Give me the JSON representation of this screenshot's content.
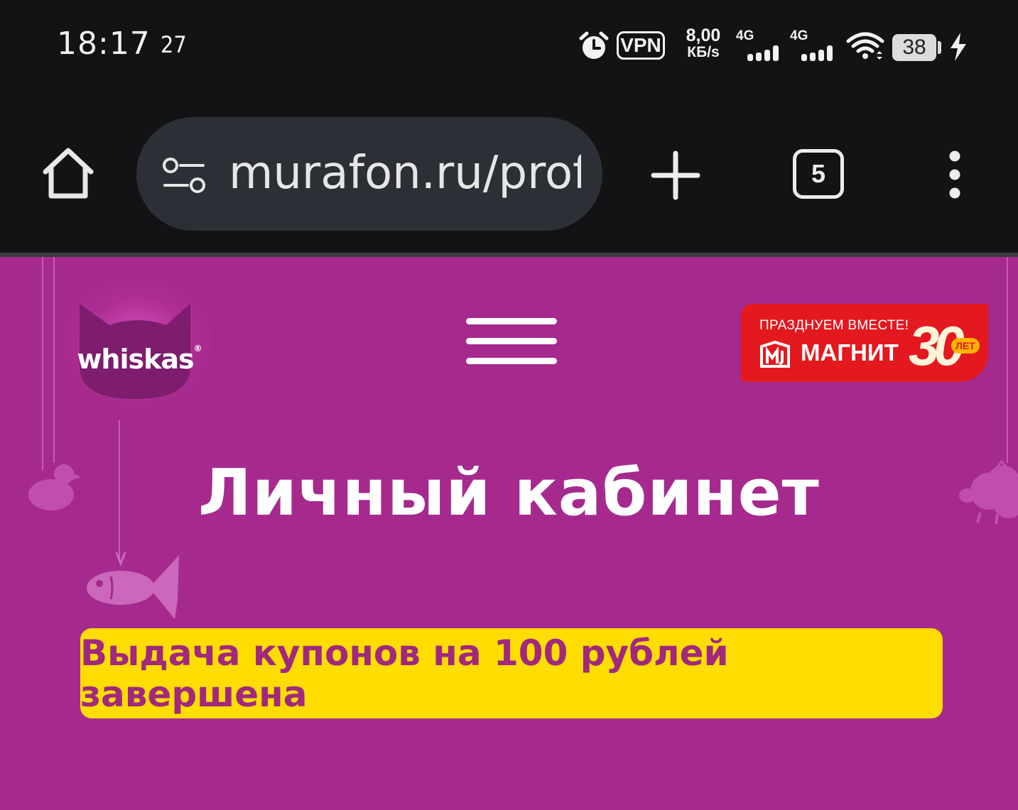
{
  "status_bar": {
    "time": "18:17",
    "temperature": "27",
    "vpn_label": "VPN",
    "speed_value": "8,00",
    "speed_unit": "КБ/s",
    "network_1": "4G",
    "network_2": "4G",
    "battery": "38",
    "icons": [
      "alarm-icon",
      "vpn-icon",
      "signal-icon",
      "wifi-icon",
      "battery-icon",
      "charging-icon"
    ]
  },
  "browser": {
    "url": "murafon.ru/profile",
    "tab_count": "5",
    "icons": [
      "home-icon",
      "site-settings-icon",
      "new-tab-icon",
      "tab-switcher-icon",
      "more-menu-icon"
    ]
  },
  "header": {
    "logo_text": "whiskas",
    "logo_mark": "®",
    "partner_banner": {
      "tagline": "ПРАЗДНУЕМ ВМЕСТЕ!",
      "brand": "МАГНИТ",
      "number": "30",
      "suffix": "ЛЕТ"
    }
  },
  "main": {
    "title": "Личный кабинет",
    "notice": "Выдача купонов на 100 рублей завершена"
  },
  "colors": {
    "page_bg": "#a62a8d",
    "notice_bg": "#ffdd00",
    "notice_text": "#a0287e",
    "browser_bg": "#131315",
    "url_pill": "#2c2f36",
    "magnit_red": "#e4181f"
  }
}
